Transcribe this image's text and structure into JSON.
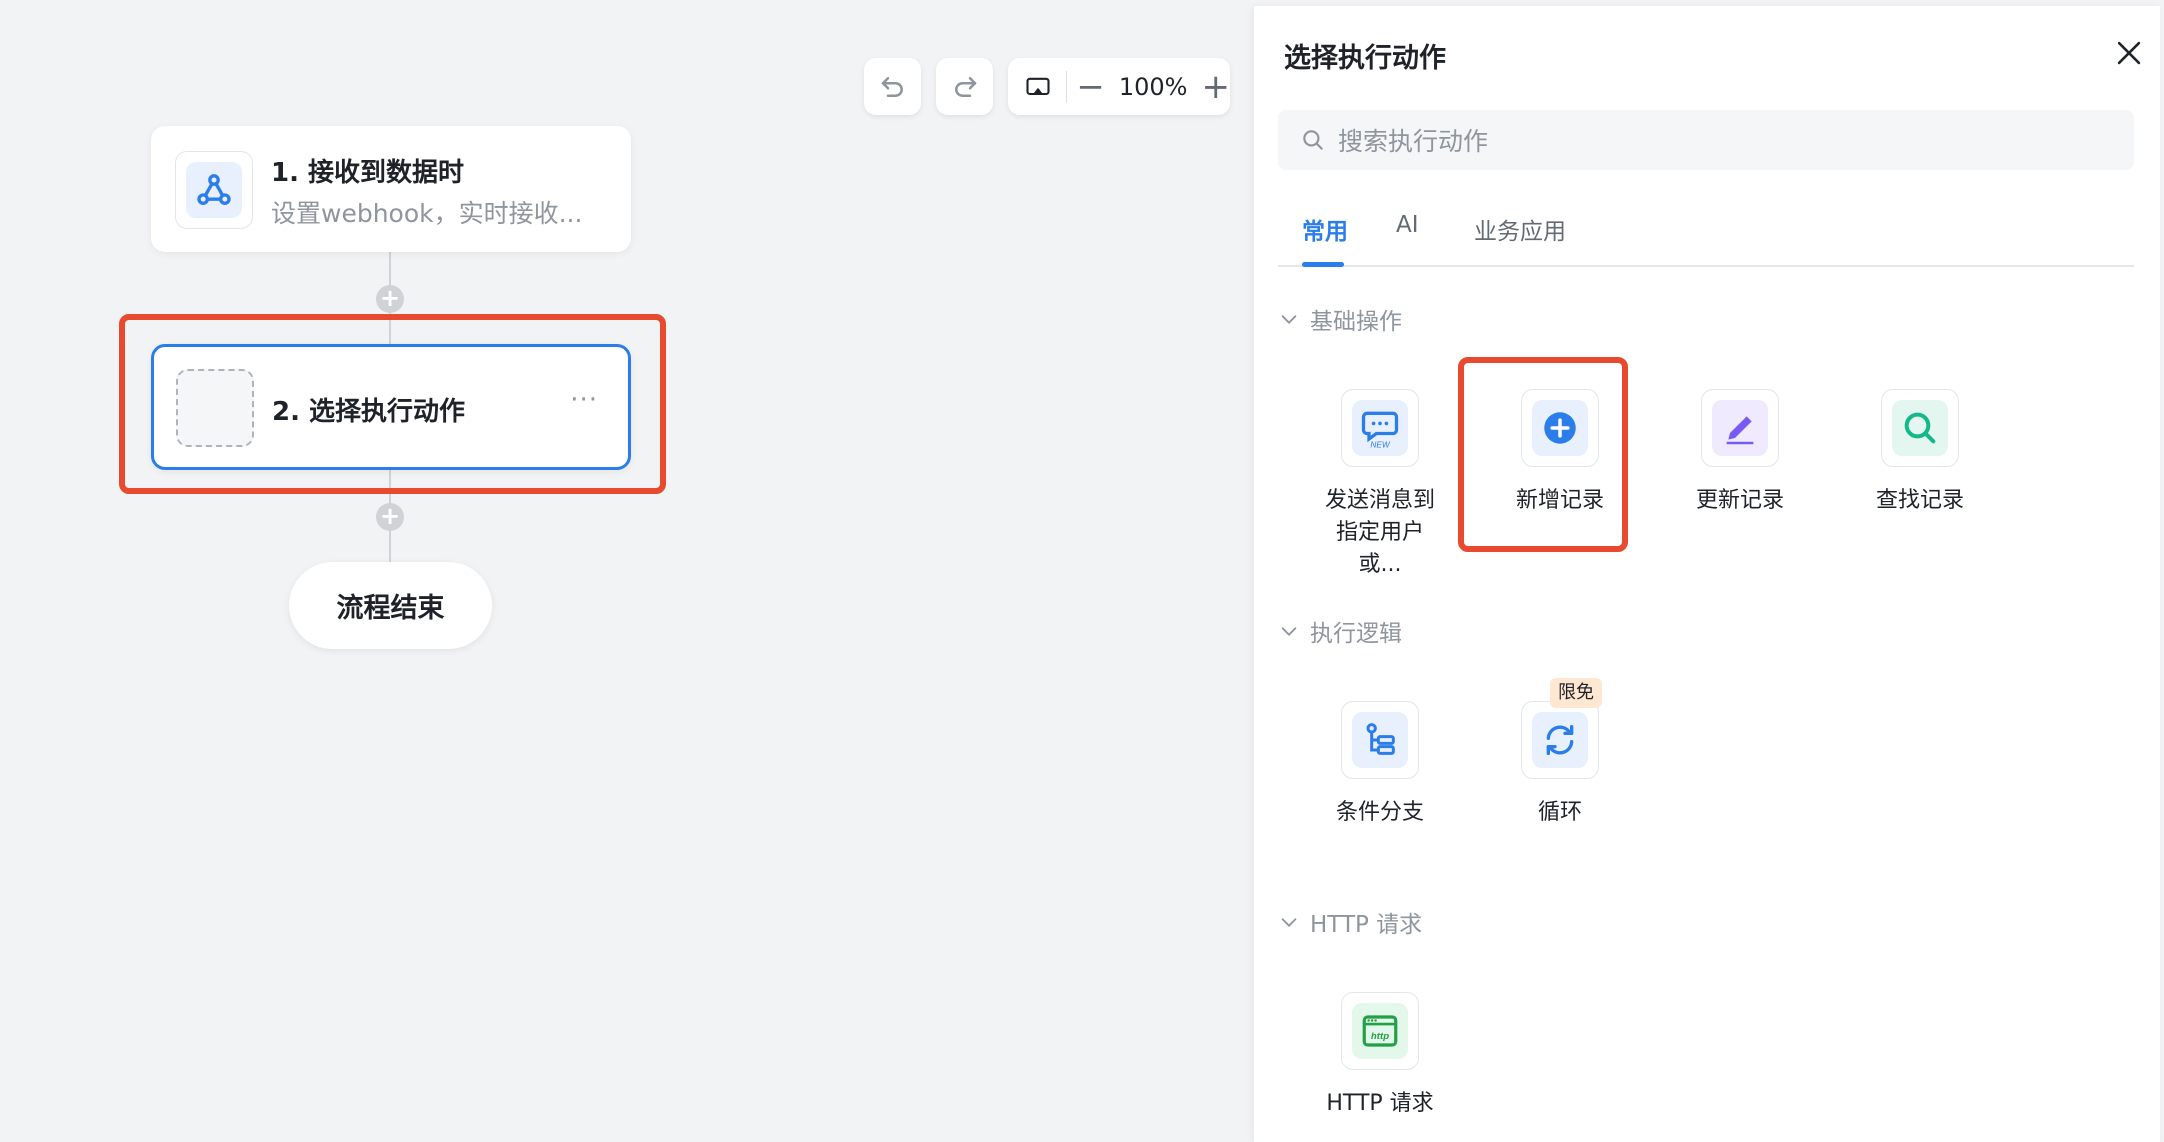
{
  "toolbar": {
    "undo_icon": "undo-icon",
    "redo_icon": "redo-icon",
    "fit_icon": "fit-screen-icon",
    "zoom_value": "100%",
    "zoom_out": "−",
    "zoom_in": "+"
  },
  "flow": {
    "node1": {
      "title": "1. 接收到数据时",
      "subtitle": "设置webhook，实时接收...",
      "icon": "webhook-icon"
    },
    "node2": {
      "title": "2. 选择执行动作",
      "more": "···"
    },
    "add_icon": "+",
    "end_label": "流程结束"
  },
  "panel": {
    "title": "选择执行动作",
    "close_icon": "close-icon",
    "search_placeholder": "搜索执行动作",
    "tabs": [
      {
        "label": "常用",
        "active": true
      },
      {
        "label": "AI",
        "active": false
      },
      {
        "label": "业务应用",
        "active": false
      }
    ],
    "sections": [
      {
        "title": "基础操作",
        "items": [
          {
            "label": "发送消息到指定用户或...",
            "icon": "message-new-icon"
          },
          {
            "label": "新增记录",
            "icon": "add-record-icon"
          },
          {
            "label": "更新记录",
            "icon": "edit-record-icon"
          },
          {
            "label": "查找记录",
            "icon": "search-record-icon"
          }
        ]
      },
      {
        "title": "执行逻辑",
        "items": [
          {
            "label": "条件分支",
            "icon": "branch-icon"
          },
          {
            "label": "循环",
            "icon": "loop-icon",
            "badge": "限免"
          }
        ]
      },
      {
        "title": "HTTP 请求",
        "items": [
          {
            "label": "HTTP 请求",
            "icon": "http-icon"
          }
        ]
      }
    ]
  },
  "colors": {
    "accent": "#2b7de9",
    "highlight": "#e84a2f",
    "canvas_bg": "#f2f3f5"
  }
}
